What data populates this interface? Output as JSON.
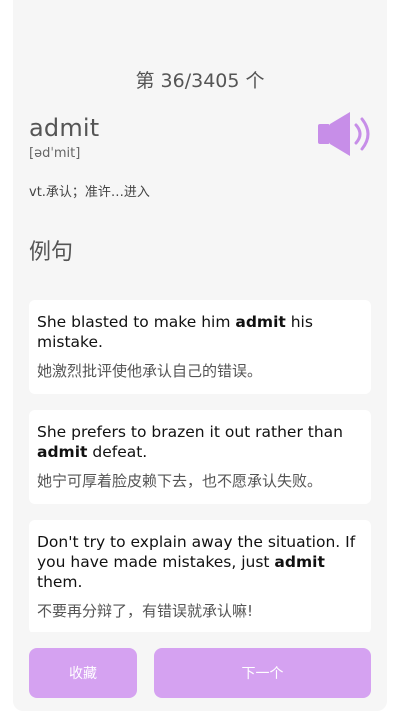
{
  "header": {
    "counter": "第 36/3405 个"
  },
  "word": {
    "text": "admit",
    "phonetic": "[ədˈmit]",
    "meaning": "vt.承认；准许…进入"
  },
  "section_title": "例句",
  "examples": [
    {
      "en_before": "She blasted to make him ",
      "en_keyword": "admit",
      "en_after": " his mistake.",
      "zh": "她激烈批评使他承认自己的错误。"
    },
    {
      "en_before": "She prefers to brazen it out rather than ",
      "en_keyword": "admit",
      "en_after": " defeat.",
      "zh": "她宁可厚着脸皮赖下去，也不愿承认失败。"
    },
    {
      "en_before": "Don't try to explain away the situation. If you have made mistakes, just ",
      "en_keyword": "admit",
      "en_after": " them.",
      "zh": "不要再分辩了，有错误就承认嘛!"
    }
  ],
  "buttons": {
    "favorite": "收藏",
    "next": "下一个"
  },
  "colors": {
    "accent": "#d5a2f1",
    "speaker": "#c78ee8",
    "panel": "#f6f6f6",
    "card": "#ffffff"
  },
  "icons": {
    "speaker": "speaker-volume-icon"
  }
}
